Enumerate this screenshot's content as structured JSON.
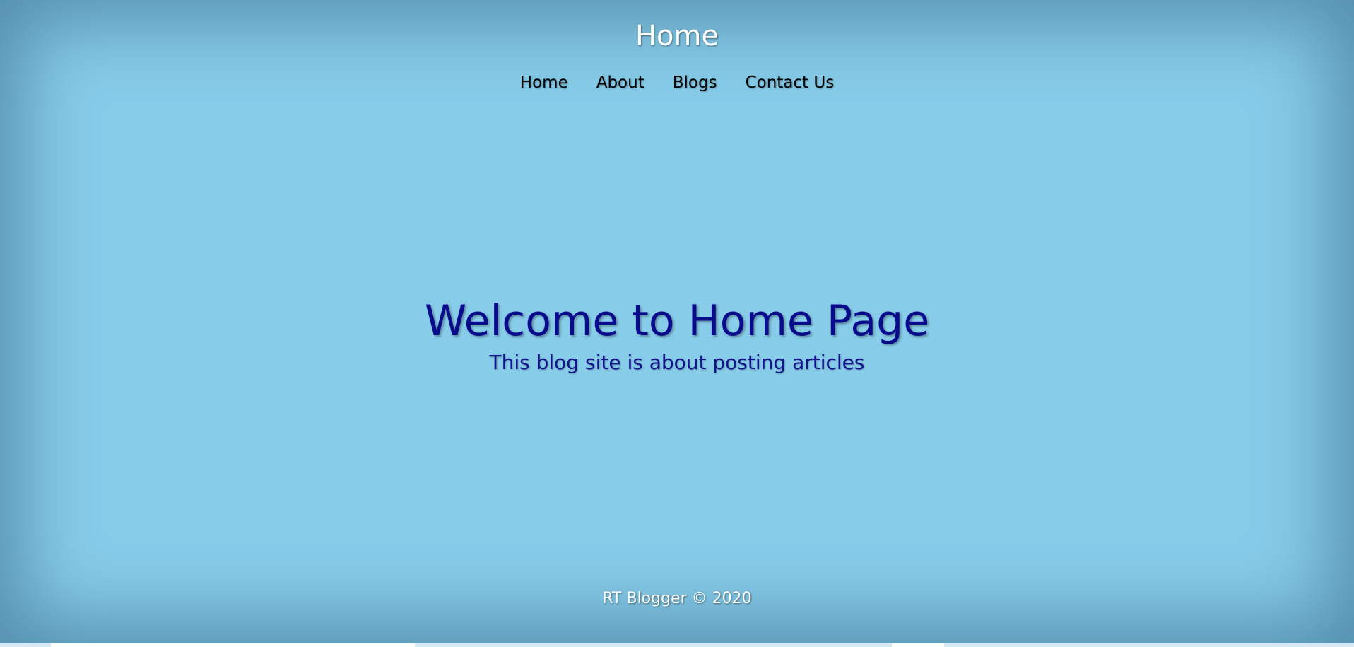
{
  "header": {
    "title": "Home"
  },
  "nav": {
    "items": [
      {
        "label": "Home"
      },
      {
        "label": "About"
      },
      {
        "label": "Blogs"
      },
      {
        "label": "Contact Us"
      }
    ]
  },
  "hero": {
    "title": "Welcome to Home Page",
    "subtitle": "This blog site is about posting articles"
  },
  "footer": {
    "text": "RT Blogger © 2020"
  },
  "colors": {
    "background": "#87cce9",
    "title_text": "#ffffff",
    "hero_text": "#0a0a8c",
    "nav_text": "#000000"
  }
}
